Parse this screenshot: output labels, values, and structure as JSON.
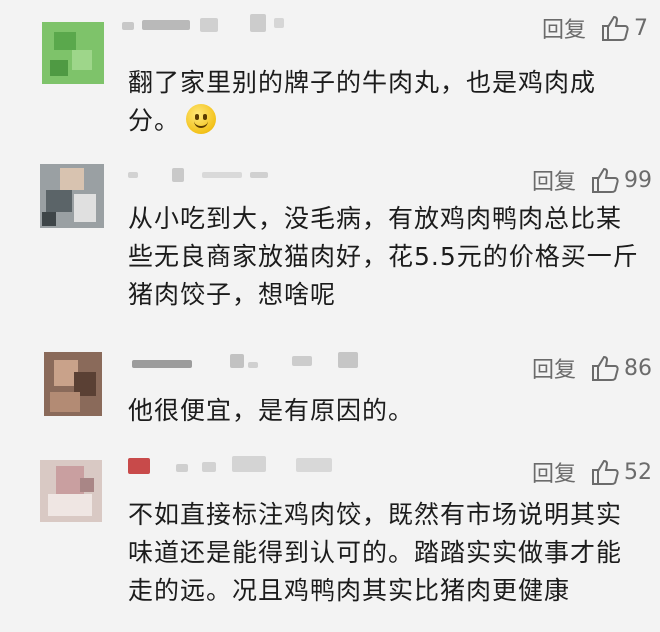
{
  "comments": [
    {
      "reply_label": "回复",
      "likes": "7",
      "text": "翻了家里别的牌子的牛肉丸，也是鸡肉成分。",
      "emoji": "smiley-emoji"
    },
    {
      "reply_label": "回复",
      "likes": "99",
      "text": "从小吃到大，没毛病，有放鸡肉鸭肉总比某些无良商家放猫肉好，花5.5元的价格买一斤猪肉饺子，想啥呢"
    },
    {
      "reply_label": "回复",
      "likes": "86",
      "text": "他很便宜，是有原因的。"
    },
    {
      "reply_label": "回复",
      "likes": "52",
      "text": "不如直接标注鸡肉饺，既然有市场说明其实味道还是能得到认可的。踏踏实实做事才能走的远。况且鸡鸭肉其实比猪肉更健康"
    }
  ],
  "icons": {
    "like": "thumbs-up-icon"
  },
  "colors": {
    "background": "#f3f3f3",
    "action_text": "#6b6b6b",
    "comment_text": "#1c1c1c"
  }
}
